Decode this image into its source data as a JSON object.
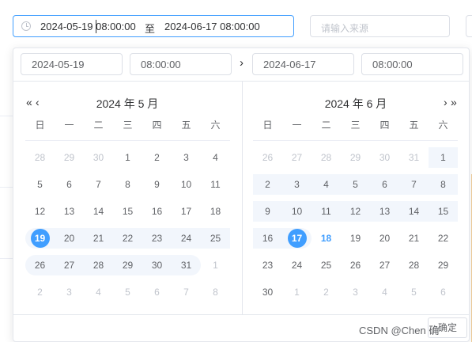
{
  "range": {
    "start": "2024-05-19 08:00:00",
    "separator": "至",
    "end": "2024-06-17 08:00:00"
  },
  "source": {
    "placeholder": "请输入来源"
  },
  "panel": {
    "start_date": "2024-05-19",
    "start_time": "08:00:00",
    "end_date": "2024-06-17",
    "end_time": "08:00:00",
    "arrow": "›",
    "prev_year": "«",
    "prev_month": "‹",
    "next_month": "›",
    "next_year": "»",
    "left_title": "2024 年 5 月",
    "right_title": "2024 年 6 月",
    "weekdays": [
      "日",
      "一",
      "二",
      "三",
      "四",
      "五",
      "六"
    ],
    "confirm_label": "确定",
    "left_days": [
      [
        [
          "28",
          "other"
        ],
        [
          "29",
          "other"
        ],
        [
          "30",
          "other"
        ],
        [
          "1",
          ""
        ],
        [
          "2",
          ""
        ],
        [
          "3",
          ""
        ],
        [
          "4",
          ""
        ]
      ],
      [
        [
          "5",
          ""
        ],
        [
          "6",
          ""
        ],
        [
          "7",
          ""
        ],
        [
          "8",
          ""
        ],
        [
          "9",
          ""
        ],
        [
          "10",
          ""
        ],
        [
          "11",
          ""
        ]
      ],
      [
        [
          "12",
          ""
        ],
        [
          "13",
          ""
        ],
        [
          "14",
          ""
        ],
        [
          "15",
          ""
        ],
        [
          "16",
          ""
        ],
        [
          "17",
          ""
        ],
        [
          "18",
          ""
        ]
      ],
      [
        [
          "19",
          "sel in-start"
        ],
        [
          "20",
          "in"
        ],
        [
          "21",
          "in"
        ],
        [
          "22",
          "in"
        ],
        [
          "23",
          "in"
        ],
        [
          "24",
          "in"
        ],
        [
          "25",
          "in"
        ]
      ],
      [
        [
          "26",
          "in-start"
        ],
        [
          "27",
          "in"
        ],
        [
          "28",
          "in"
        ],
        [
          "29",
          "in"
        ],
        [
          "30",
          "in"
        ],
        [
          "31",
          "in-end"
        ],
        [
          "1",
          "other"
        ]
      ],
      [
        [
          "2",
          "other"
        ],
        [
          "3",
          "other"
        ],
        [
          "4",
          "other"
        ],
        [
          "5",
          "other"
        ],
        [
          "6",
          "other"
        ],
        [
          "7",
          "other"
        ],
        [
          "8",
          "other"
        ]
      ]
    ],
    "right_days": [
      [
        [
          "26",
          "other"
        ],
        [
          "27",
          "other"
        ],
        [
          "28",
          "other"
        ],
        [
          "29",
          "other"
        ],
        [
          "30",
          "other"
        ],
        [
          "31",
          "other"
        ],
        [
          "1",
          "in"
        ]
      ],
      [
        [
          "2",
          "in"
        ],
        [
          "3",
          "in"
        ],
        [
          "4",
          "in"
        ],
        [
          "5",
          "in"
        ],
        [
          "6",
          "in"
        ],
        [
          "7",
          "in"
        ],
        [
          "8",
          "in"
        ]
      ],
      [
        [
          "9",
          "in"
        ],
        [
          "10",
          "in"
        ],
        [
          "11",
          "in"
        ],
        [
          "12",
          "in"
        ],
        [
          "13",
          "in"
        ],
        [
          "14",
          "in"
        ],
        [
          "15",
          "in"
        ]
      ],
      [
        [
          "16",
          "in"
        ],
        [
          "17",
          "sel in-end"
        ],
        [
          "18",
          "today"
        ],
        [
          "19",
          ""
        ],
        [
          "20",
          ""
        ],
        [
          "21",
          ""
        ],
        [
          "22",
          ""
        ]
      ],
      [
        [
          "23",
          ""
        ],
        [
          "24",
          ""
        ],
        [
          "25",
          ""
        ],
        [
          "26",
          ""
        ],
        [
          "27",
          ""
        ],
        [
          "28",
          ""
        ],
        [
          "29",
          ""
        ]
      ],
      [
        [
          "30",
          ""
        ],
        [
          "1",
          "other"
        ],
        [
          "2",
          "other"
        ],
        [
          "3",
          "other"
        ],
        [
          "4",
          "other"
        ],
        [
          "5",
          "other"
        ],
        [
          "6",
          "other"
        ]
      ]
    ]
  },
  "watermark": "CSDN @Chen 确"
}
